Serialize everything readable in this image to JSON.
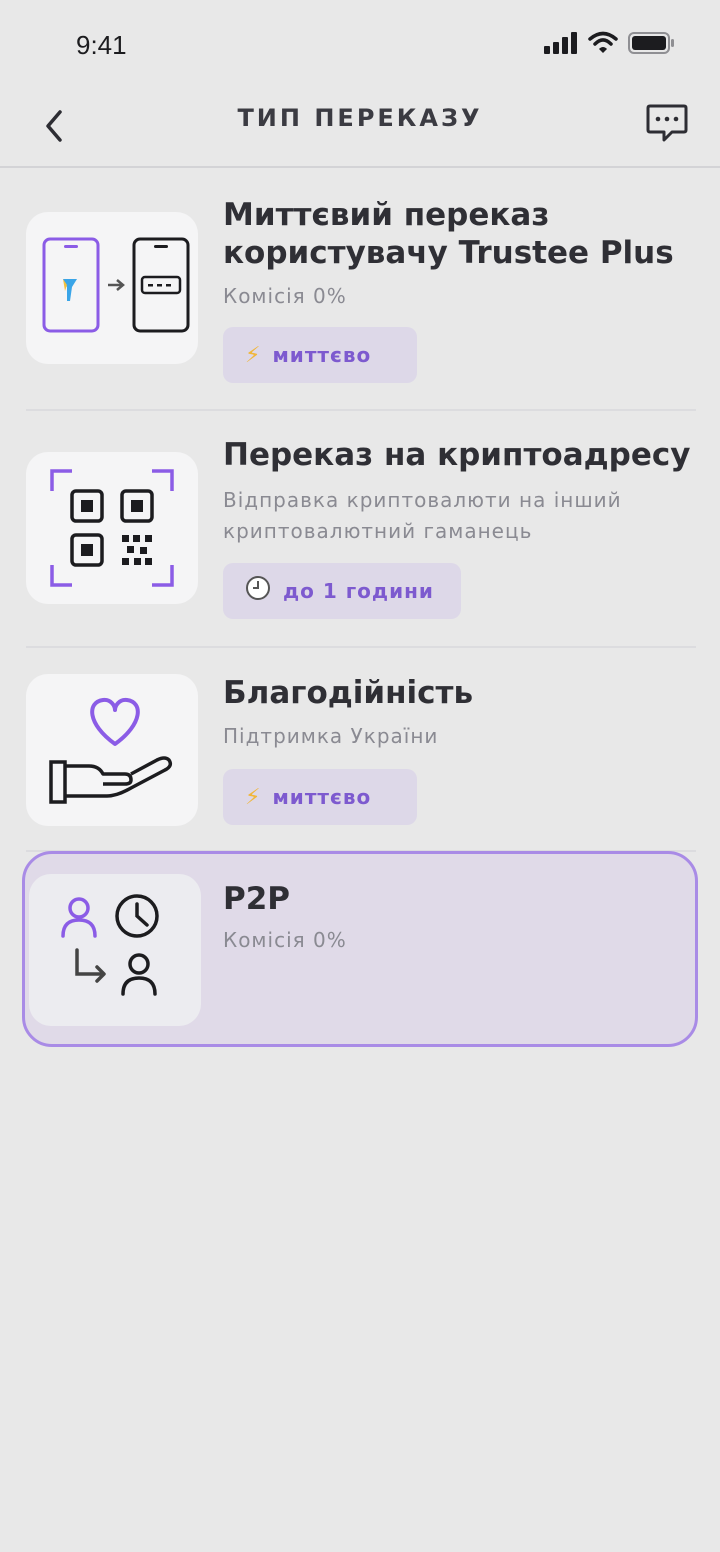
{
  "status": {
    "time": "9:41",
    "signal_icon": "signal-icon",
    "wifi_icon": "wifi-icon",
    "battery_icon": "battery-icon"
  },
  "header": {
    "title": "ТИП ПЕРЕКАЗУ",
    "back_icon": "chevron-left-icon",
    "chat_icon": "chat-icon"
  },
  "colors": {
    "accent": "#8b5ce6",
    "background": "#e8e8e8",
    "badge_bg": "#ddd8e8",
    "selected_border": "#a98be6"
  },
  "options": [
    {
      "title_line1": "Миттєвий переказ",
      "title_line2": "користувачу Trustee Plus",
      "subtitle": "Комісія 0%",
      "badge": {
        "icon": "lightning-icon",
        "label": "миттєво"
      }
    },
    {
      "title_line1": "Переказ на криптоадресу",
      "subtitle_line1": "Відправка криптовалюти на інший",
      "subtitle_line2": "криптовалютний гаманець",
      "badge": {
        "icon": "clock-icon",
        "label": "до 1 години"
      }
    },
    {
      "title_line1": "Благодійність",
      "subtitle": "Підтримка України",
      "badge": {
        "icon": "lightning-icon",
        "label": "миттєво"
      }
    },
    {
      "title_line1": "P2P",
      "subtitle": "Комісія 0%",
      "selected": true
    }
  ]
}
